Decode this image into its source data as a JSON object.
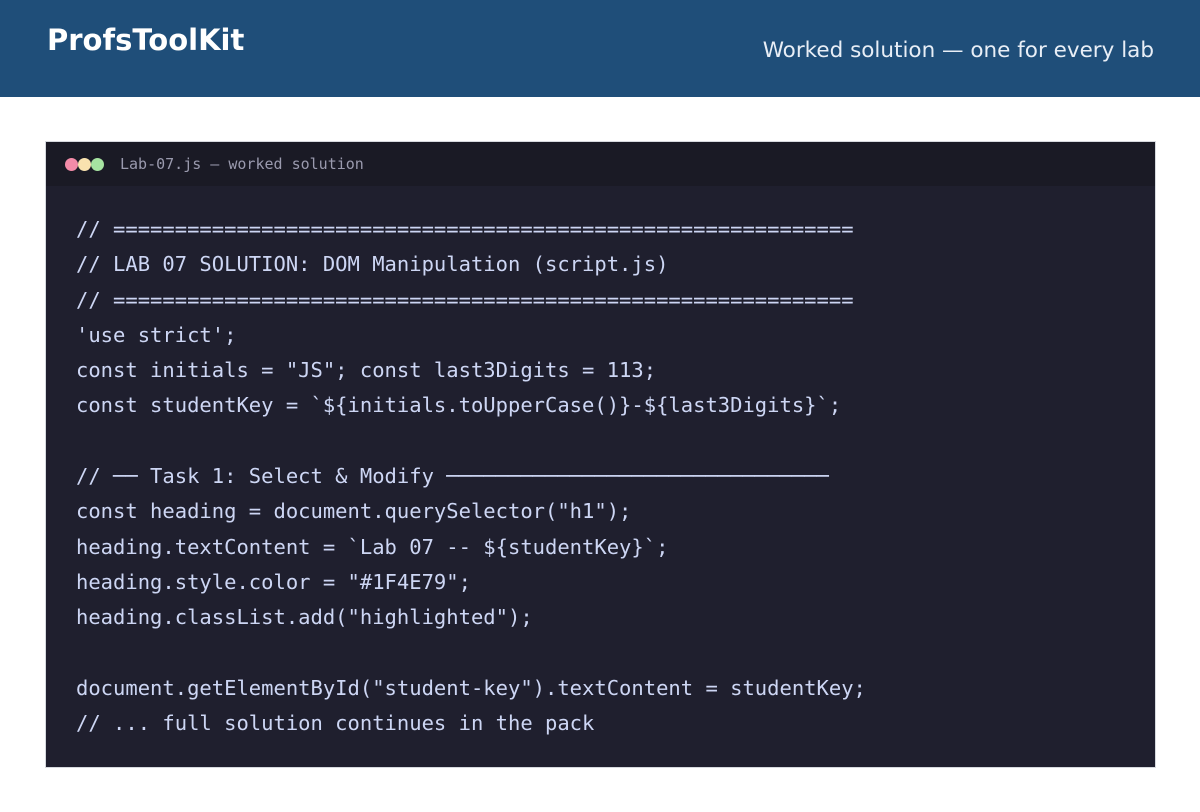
{
  "header": {
    "brand": "ProfsToolKit",
    "tagline": "Worked solution — one for every lab",
    "background_color": "#1F4E79"
  },
  "editor": {
    "window_dots": [
      {
        "name": "close",
        "color": "#F38BA8"
      },
      {
        "name": "minimize",
        "color": "#F9E2AF"
      },
      {
        "name": "maximize",
        "color": "#A6E3A1"
      }
    ],
    "filename": "Lab-07.js — worked solution",
    "background_color": "#1F1F2E",
    "text_color": "#CDD6F4",
    "lines": [
      "// ============================================================",
      "// LAB 07 SOLUTION: DOM Manipulation (script.js)",
      "// ============================================================",
      "'use strict';",
      "const initials = \"JS\"; const last3Digits = 113;",
      "const studentKey = `${initials.toUpperCase()}-${last3Digits}`;",
      "",
      "// ── Task 1: Select & Modify ───────────────────────────────",
      "const heading = document.querySelector(\"h1\");",
      "heading.textContent = `Lab 07 -- ${studentKey}`;",
      "heading.style.color = \"#1F4E79\";",
      "heading.classList.add(\"highlighted\");",
      "",
      "document.getElementById(\"student-key\").textContent = studentKey;",
      "// ... full solution continues in the pack"
    ]
  }
}
